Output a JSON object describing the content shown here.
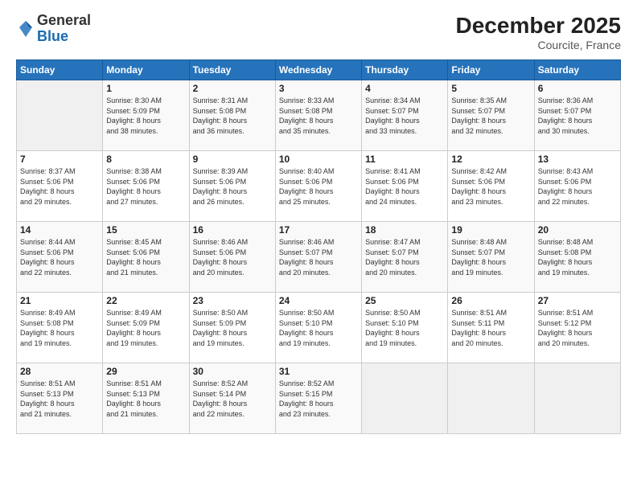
{
  "logo": {
    "general": "General",
    "blue": "Blue"
  },
  "header": {
    "month": "December 2025",
    "location": "Courcite, France"
  },
  "days_header": [
    "Sunday",
    "Monday",
    "Tuesday",
    "Wednesday",
    "Thursday",
    "Friday",
    "Saturday"
  ],
  "weeks": [
    [
      {
        "day": "",
        "info": ""
      },
      {
        "day": "1",
        "info": "Sunrise: 8:30 AM\nSunset: 5:09 PM\nDaylight: 8 hours\nand 38 minutes."
      },
      {
        "day": "2",
        "info": "Sunrise: 8:31 AM\nSunset: 5:08 PM\nDaylight: 8 hours\nand 36 minutes."
      },
      {
        "day": "3",
        "info": "Sunrise: 8:33 AM\nSunset: 5:08 PM\nDaylight: 8 hours\nand 35 minutes."
      },
      {
        "day": "4",
        "info": "Sunrise: 8:34 AM\nSunset: 5:07 PM\nDaylight: 8 hours\nand 33 minutes."
      },
      {
        "day": "5",
        "info": "Sunrise: 8:35 AM\nSunset: 5:07 PM\nDaylight: 8 hours\nand 32 minutes."
      },
      {
        "day": "6",
        "info": "Sunrise: 8:36 AM\nSunset: 5:07 PM\nDaylight: 8 hours\nand 30 minutes."
      }
    ],
    [
      {
        "day": "7",
        "info": "Sunrise: 8:37 AM\nSunset: 5:06 PM\nDaylight: 8 hours\nand 29 minutes."
      },
      {
        "day": "8",
        "info": "Sunrise: 8:38 AM\nSunset: 5:06 PM\nDaylight: 8 hours\nand 27 minutes."
      },
      {
        "day": "9",
        "info": "Sunrise: 8:39 AM\nSunset: 5:06 PM\nDaylight: 8 hours\nand 26 minutes."
      },
      {
        "day": "10",
        "info": "Sunrise: 8:40 AM\nSunset: 5:06 PM\nDaylight: 8 hours\nand 25 minutes."
      },
      {
        "day": "11",
        "info": "Sunrise: 8:41 AM\nSunset: 5:06 PM\nDaylight: 8 hours\nand 24 minutes."
      },
      {
        "day": "12",
        "info": "Sunrise: 8:42 AM\nSunset: 5:06 PM\nDaylight: 8 hours\nand 23 minutes."
      },
      {
        "day": "13",
        "info": "Sunrise: 8:43 AM\nSunset: 5:06 PM\nDaylight: 8 hours\nand 22 minutes."
      }
    ],
    [
      {
        "day": "14",
        "info": "Sunrise: 8:44 AM\nSunset: 5:06 PM\nDaylight: 8 hours\nand 22 minutes."
      },
      {
        "day": "15",
        "info": "Sunrise: 8:45 AM\nSunset: 5:06 PM\nDaylight: 8 hours\nand 21 minutes."
      },
      {
        "day": "16",
        "info": "Sunrise: 8:46 AM\nSunset: 5:06 PM\nDaylight: 8 hours\nand 20 minutes."
      },
      {
        "day": "17",
        "info": "Sunrise: 8:46 AM\nSunset: 5:07 PM\nDaylight: 8 hours\nand 20 minutes."
      },
      {
        "day": "18",
        "info": "Sunrise: 8:47 AM\nSunset: 5:07 PM\nDaylight: 8 hours\nand 20 minutes."
      },
      {
        "day": "19",
        "info": "Sunrise: 8:48 AM\nSunset: 5:07 PM\nDaylight: 8 hours\nand 19 minutes."
      },
      {
        "day": "20",
        "info": "Sunrise: 8:48 AM\nSunset: 5:08 PM\nDaylight: 8 hours\nand 19 minutes."
      }
    ],
    [
      {
        "day": "21",
        "info": "Sunrise: 8:49 AM\nSunset: 5:08 PM\nDaylight: 8 hours\nand 19 minutes."
      },
      {
        "day": "22",
        "info": "Sunrise: 8:49 AM\nSunset: 5:09 PM\nDaylight: 8 hours\nand 19 minutes."
      },
      {
        "day": "23",
        "info": "Sunrise: 8:50 AM\nSunset: 5:09 PM\nDaylight: 8 hours\nand 19 minutes."
      },
      {
        "day": "24",
        "info": "Sunrise: 8:50 AM\nSunset: 5:10 PM\nDaylight: 8 hours\nand 19 minutes."
      },
      {
        "day": "25",
        "info": "Sunrise: 8:50 AM\nSunset: 5:10 PM\nDaylight: 8 hours\nand 19 minutes."
      },
      {
        "day": "26",
        "info": "Sunrise: 8:51 AM\nSunset: 5:11 PM\nDaylight: 8 hours\nand 20 minutes."
      },
      {
        "day": "27",
        "info": "Sunrise: 8:51 AM\nSunset: 5:12 PM\nDaylight: 8 hours\nand 20 minutes."
      }
    ],
    [
      {
        "day": "28",
        "info": "Sunrise: 8:51 AM\nSunset: 5:13 PM\nDaylight: 8 hours\nand 21 minutes."
      },
      {
        "day": "29",
        "info": "Sunrise: 8:51 AM\nSunset: 5:13 PM\nDaylight: 8 hours\nand 21 minutes."
      },
      {
        "day": "30",
        "info": "Sunrise: 8:52 AM\nSunset: 5:14 PM\nDaylight: 8 hours\nand 22 minutes."
      },
      {
        "day": "31",
        "info": "Sunrise: 8:52 AM\nSunset: 5:15 PM\nDaylight: 8 hours\nand 23 minutes."
      },
      {
        "day": "",
        "info": ""
      },
      {
        "day": "",
        "info": ""
      },
      {
        "day": "",
        "info": ""
      }
    ]
  ]
}
